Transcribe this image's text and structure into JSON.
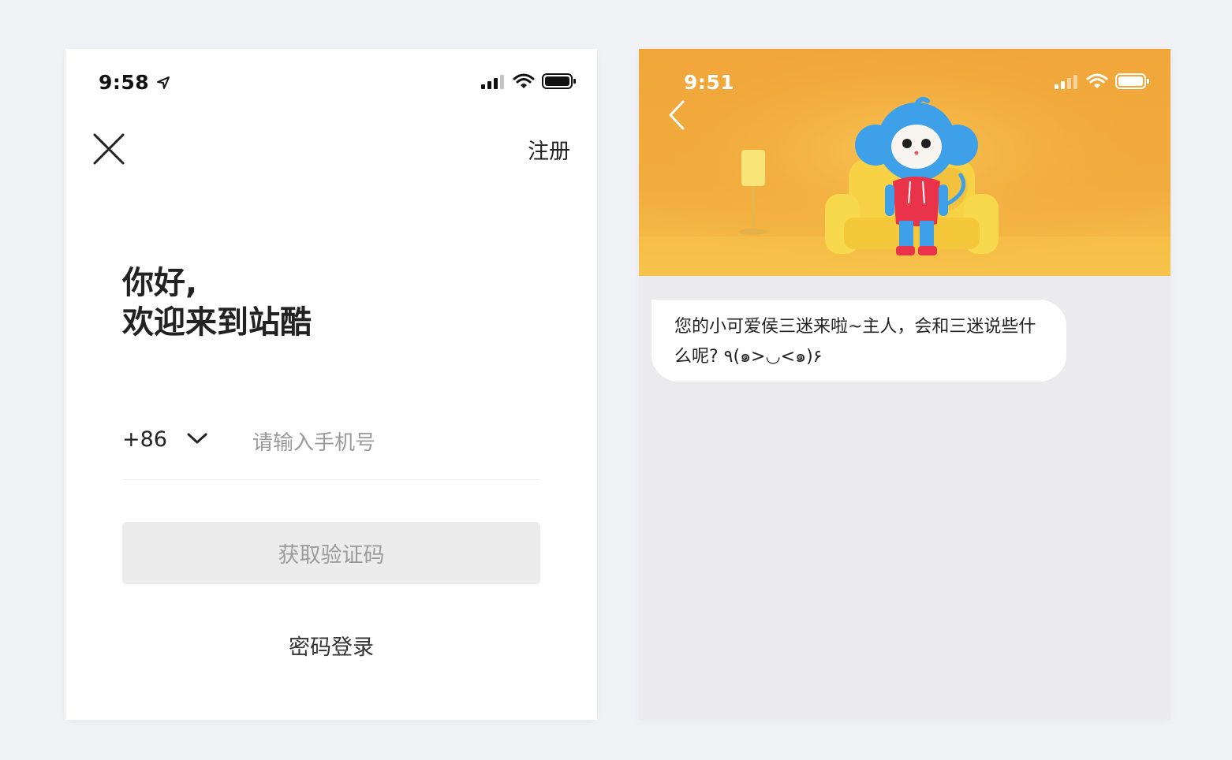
{
  "login_screen": {
    "status_time": "9:58",
    "register_label": "注册",
    "greeting_line1": "你好,",
    "greeting_line2": "欢迎来到站酷",
    "country_code": "+86",
    "phone_placeholder": "请输入手机号",
    "get_code_label": "获取验证码",
    "password_login_label": "密码登录"
  },
  "chat_screen": {
    "status_time": "9:51",
    "message": "您的小可爱侯三迷来啦~主人，会和三迷说些什么呢? ٩(๑>◡<๑)۶"
  },
  "icons": {
    "close": "close-icon",
    "chevron": "chevron-down-icon",
    "back": "back-arrow-icon",
    "location": "location-arrow-icon",
    "signal": "signal-icon",
    "wifi": "wifi-icon",
    "battery": "battery-icon"
  },
  "colors": {
    "page_background": "#f0f2f5",
    "banner": "#f2a93c",
    "button_disabled": "#ececec",
    "chat_background": "#ebebed",
    "mascot_blue": "#3ea0e8",
    "mascot_hoodie": "#e8334a"
  }
}
